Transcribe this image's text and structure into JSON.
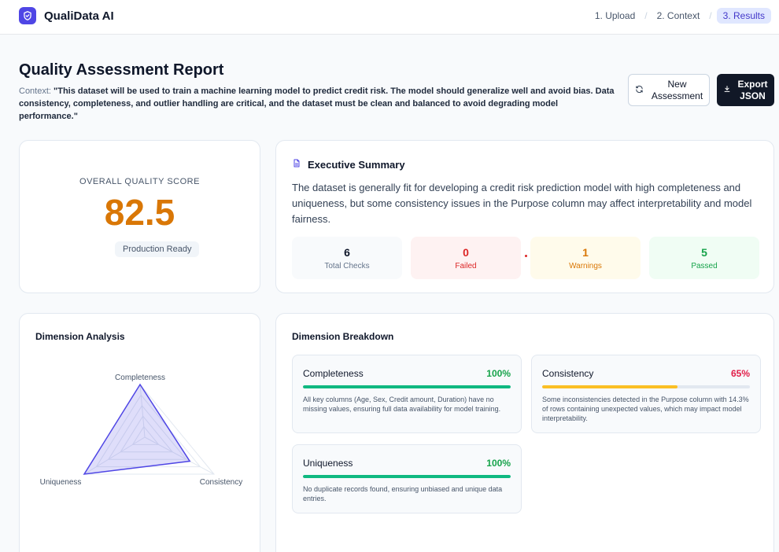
{
  "app": {
    "name": "QualiData AI"
  },
  "steps": [
    {
      "label": "1. Upload"
    },
    {
      "label": "2. Context"
    },
    {
      "label": "3. Results"
    }
  ],
  "report": {
    "title": "Quality Assessment Report",
    "context_label": "Context: ",
    "context_text": "\"This dataset will be used to train a machine learning model to predict credit risk. The model should generalize well and avoid bias. Data consistency, completeness, and outlier handling are critical, and the dataset must be clean and balanced to avoid degrading model performance.\""
  },
  "buttons": {
    "new_line1": "New",
    "new_line2": "Assessment",
    "export_line1": "Export",
    "export_line2": "JSON"
  },
  "score": {
    "label": "OVERALL QUALITY SCORE",
    "value": "82.5",
    "badge": "Production Ready"
  },
  "summary": {
    "title": "Executive Summary",
    "text": "The dataset is generally fit for developing a credit risk prediction model with high completeness and uniqueness, but some consistency issues in the Purpose column may affect interpretability and model fairness.",
    "stats": {
      "total": {
        "value": "6",
        "label": "Total Checks"
      },
      "failed": {
        "value": "0",
        "label": "Failed"
      },
      "warnings": {
        "value": "1",
        "label": "Warnings"
      },
      "passed": {
        "value": "5",
        "label": "Passed"
      }
    }
  },
  "radar": {
    "title": "Dimension Analysis",
    "labels": {
      "top": "Completeness",
      "left": "Uniqueness",
      "right": "Consistency"
    },
    "values": {
      "completeness": 100,
      "uniqueness": 100,
      "consistency": 65
    },
    "max": 100,
    "color": "#4f46e5"
  },
  "breakdown": {
    "title": "Dimension Breakdown",
    "items": [
      {
        "name": "Completeness",
        "pct": "100%",
        "value": 100,
        "color": "#10b981",
        "pct_color": "#16a34a",
        "desc": "All key columns (Age, Sex, Credit amount, Duration) have no missing values, ensuring full data availability for model training."
      },
      {
        "name": "Consistency",
        "pct": "65%",
        "value": 65,
        "color": "#fbbf24",
        "pct_color": "#e11d48",
        "desc": "Some inconsistencies detected in the Purpose column with 14.3% of rows containing unexpected values, which may impact model interpretability."
      },
      {
        "name": "Uniqueness",
        "pct": "100%",
        "value": 100,
        "color": "#10b981",
        "pct_color": "#16a34a",
        "desc": "No duplicate records found, ensuring unbiased and unique data entries."
      }
    ]
  }
}
